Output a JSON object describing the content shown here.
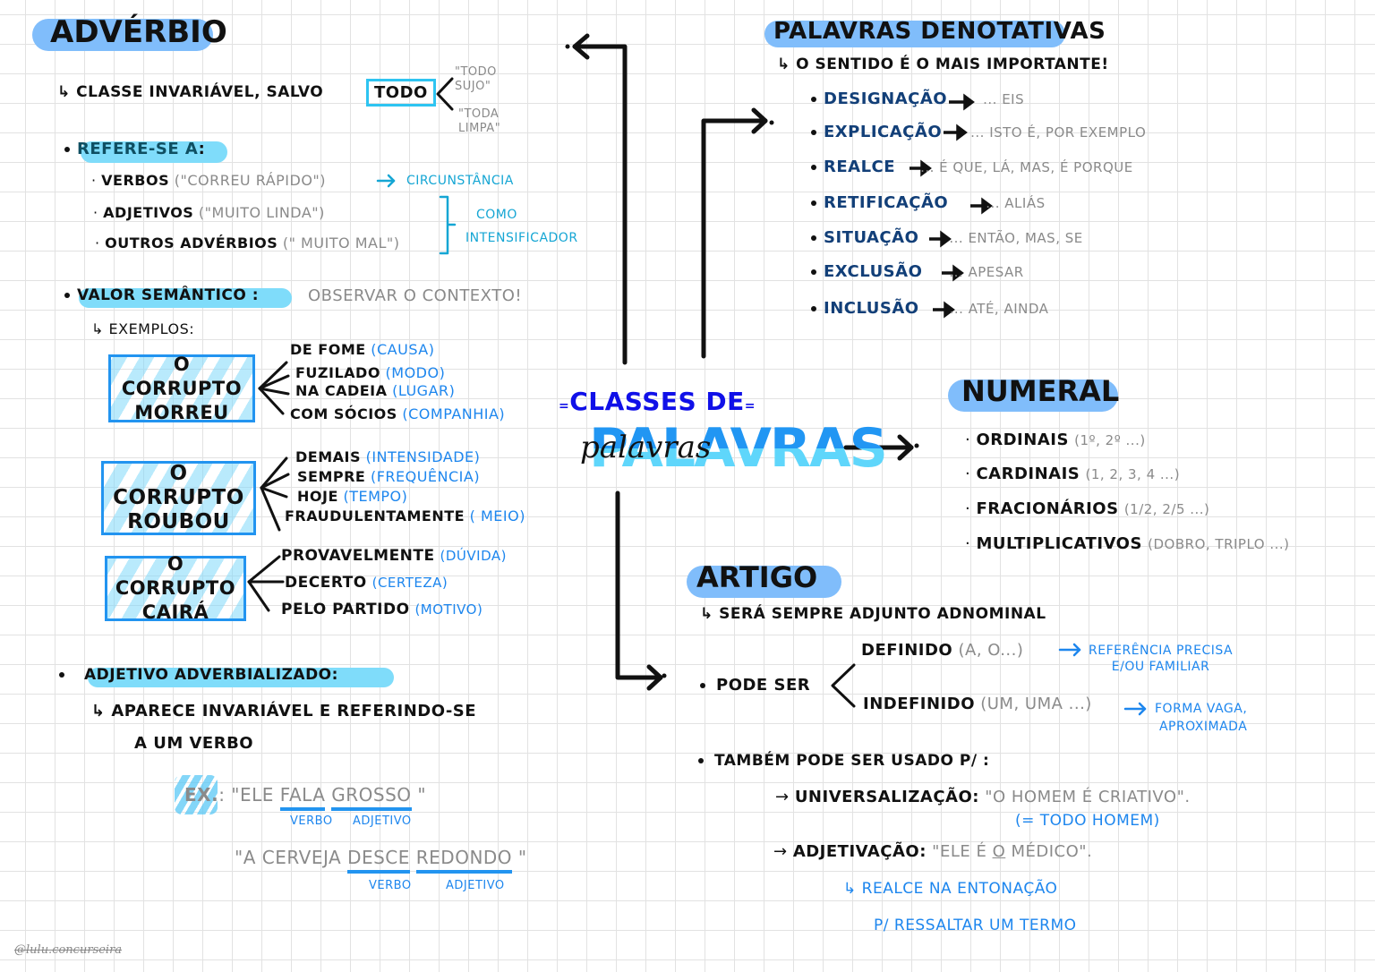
{
  "central": {
    "title_top": "Classes de",
    "title_big": "Palavras",
    "title_script": "palavras"
  },
  "adverbio": {
    "title": "Advérbio",
    "definition": "Classe invariável, salvo",
    "exception_word": "todo",
    "exception_examples": [
      "\"todo sujo\"",
      "\"toda limpa\""
    ],
    "refere_label": "Refere-se a",
    "refere_items": [
      {
        "term": "Verbos",
        "example": "(\"correu rápido\")"
      },
      {
        "term": "Adjetivos",
        "example": "(\"muito linda\")"
      },
      {
        "term": "Outros advérbios",
        "example": "(\" muito mal\")"
      }
    ],
    "circunstancia": "circunstância",
    "intensificador": [
      "como",
      "intensificador"
    ],
    "valor_label": "Valor semântico",
    "valor_note": "observar o contexto!",
    "exemplos_label": "Exemplos:",
    "examples": [
      {
        "sentence": [
          "O corrupto",
          "morreu"
        ],
        "items": [
          {
            "word": "de fome",
            "meaning": "(causa)"
          },
          {
            "word": "fuzilado",
            "meaning": "(modo)"
          },
          {
            "word": "na cadeia",
            "meaning": "(lugar)"
          },
          {
            "word": "com sócios",
            "meaning": "(companhia)"
          }
        ]
      },
      {
        "sentence": [
          "O corrupto",
          "roubou"
        ],
        "items": [
          {
            "word": "demais",
            "meaning": "(intensidade)"
          },
          {
            "word": "sempre",
            "meaning": "(frequência)"
          },
          {
            "word": "hoje",
            "meaning": "(tempo)"
          },
          {
            "word": "fraudulentamente",
            "meaning": "( meio)"
          }
        ]
      },
      {
        "sentence": [
          "O corrupto",
          "cairá"
        ],
        "items": [
          {
            "word": "provavelmente",
            "meaning": "(dúvida)"
          },
          {
            "word": "decerto",
            "meaning": "(certeza)"
          },
          {
            "word": "pelo partido",
            "meaning": "(motivo)"
          }
        ]
      }
    ],
    "adj_adv_label": "Adjetivo adverbializado:",
    "adj_adv_desc": [
      "Aparece invariável e referindo-se",
      "a um verbo"
    ],
    "ex_label": "Ex.",
    "ex1": {
      "open": "\"Ele",
      "verb": "fala",
      "adj": "grosso",
      "close": "\""
    },
    "ex2": {
      "open": "\"A cerveja",
      "verb": "desce",
      "adj": "redondo",
      "close": "\""
    },
    "verb_tag": "verbo",
    "adj_tag": "adjetivo"
  },
  "denotativas": {
    "title": "Palavras denotativas",
    "subtitle": "O sentido é o mais importante!",
    "items": [
      {
        "term": "Designação",
        "examples": "... eis"
      },
      {
        "term": "Explicação",
        "examples": "... isto é, por exemplo"
      },
      {
        "term": "Realce",
        "examples": "... é que, lá, mas, é porque"
      },
      {
        "term": "Retificação",
        "examples": "... aliás"
      },
      {
        "term": "Situação",
        "examples": "... então, mas, se"
      },
      {
        "term": "Exclusão",
        "examples": "... apesar"
      },
      {
        "term": "Inclusão",
        "examples": "... até, ainda"
      }
    ]
  },
  "numeral": {
    "title": "Numeral",
    "items": [
      {
        "term": "Ordinais",
        "examples": "(1º, 2º ...)"
      },
      {
        "term": "Cardinais",
        "examples": "(1, 2, 3, 4 ...)"
      },
      {
        "term": "Fracionários",
        "examples": "(1/2, 2/5 ...)"
      },
      {
        "term": "Multiplicativos",
        "examples": "(dobro, triplo ...)"
      }
    ]
  },
  "artigo": {
    "title": "Artigo",
    "subtitle": "Será sempre adjunto adnominal",
    "pode_ser": "Pode ser",
    "definido": {
      "term": "Definido",
      "examples": "(a, o...)",
      "note": [
        "Referência precisa",
        "e/ou familiar"
      ]
    },
    "indefinido": {
      "term": "Indefinido",
      "examples": "(um, uma ...)",
      "note": [
        "Forma vaga,",
        "aproximada"
      ]
    },
    "tambem": "Também pode ser usado p/ :",
    "universalizacao": {
      "term": "Universalização:",
      "example": "\"O homem é criativo\".",
      "note": "(= todo homem)"
    },
    "adjetivacao": {
      "term": "Adjetivação:",
      "example_pre": "\"Ele é",
      "example_o": "o",
      "example_post": "médico\".",
      "note": [
        "Realce na entonação",
        "p/ ressaltar um termo"
      ]
    }
  },
  "watermark": "@lulu.concurseira"
}
